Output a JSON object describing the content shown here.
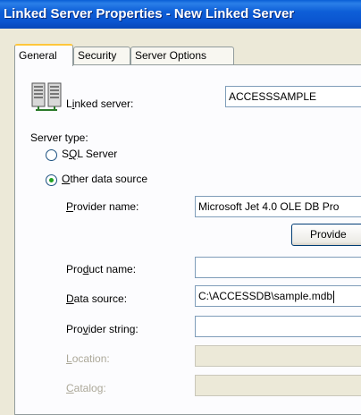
{
  "window": {
    "title": "Linked Server Properties - New Linked Server"
  },
  "tabs": [
    {
      "label": "General"
    },
    {
      "label": "Security"
    },
    {
      "label": "Server Options"
    }
  ],
  "general": {
    "linked_server_label_pre": "L",
    "linked_server_label_u": "i",
    "linked_server_label_post": "nked server:",
    "linked_server_value": "ACCESSSAMPLE",
    "server_type_label": "Server type:",
    "sql_server_label_pre": "S",
    "sql_server_label_u": "Q",
    "sql_server_label_post": "L Server",
    "other_data_source_label_pre": "",
    "other_data_source_label_u": "O",
    "other_data_source_label_post": "ther data source",
    "selected_server_type": "Other data source",
    "provider_name_label_pre": "",
    "provider_name_label_u": "P",
    "provider_name_label_post": "rovider name:",
    "provider_name_value": "Microsoft Jet 4.0 OLE DB Pro",
    "provider_button_label": "Provide",
    "product_name_label_pre": "Pro",
    "product_name_label_u": "d",
    "product_name_label_post": "uct name:",
    "product_name_value": "",
    "data_source_label_pre": "",
    "data_source_label_u": "D",
    "data_source_label_post": "ata source:",
    "data_source_value": "C:\\ACCESSDB\\sample.mdb",
    "provider_string_label_pre": "Pro",
    "provider_string_label_u": "v",
    "provider_string_label_post": "ider string:",
    "provider_string_value": "",
    "location_label_pre": "",
    "location_label_u": "L",
    "location_label_post": "ocation:",
    "location_value": "",
    "catalog_label_pre": "",
    "catalog_label_u": "C",
    "catalog_label_post": "atalog:",
    "catalog_value": ""
  },
  "icons": {
    "server": "server-icon"
  },
  "colors": {
    "title_bar": "#0a55d0",
    "accent_tab": "#ffc73c",
    "radio_dot": "#21a121"
  }
}
